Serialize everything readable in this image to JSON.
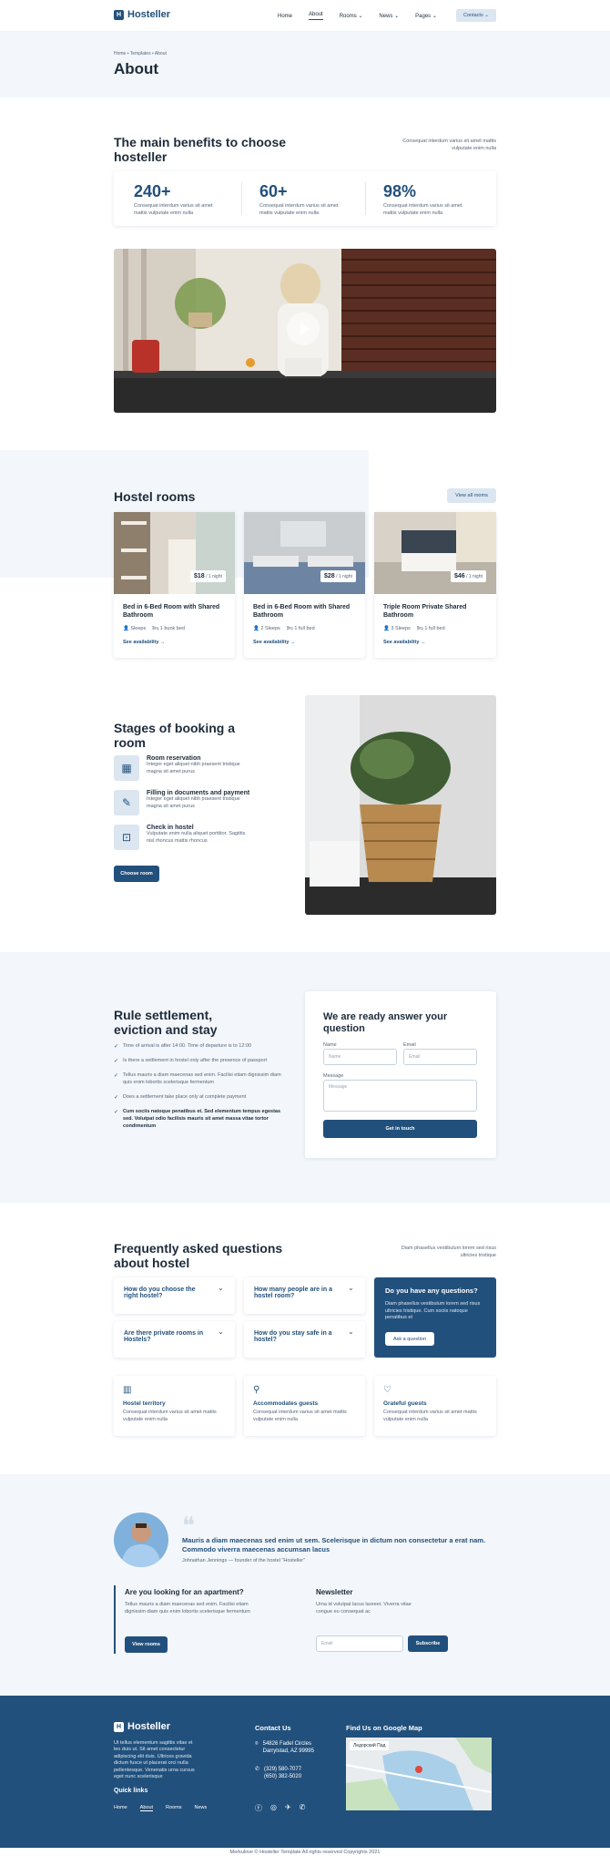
{
  "header": {
    "logo": "Hosteller",
    "nav": [
      "Home",
      "About",
      "Rooms",
      "News",
      "Pages"
    ],
    "contacts": "Contacts"
  },
  "hero": {
    "breadcrumb": "Home • Templates • About",
    "title": "About"
  },
  "benefits": {
    "title": "The main benefits to choose hosteller",
    "side": "Consequat interdum varius sit amet mattis vulputate enim nulla",
    "stats": [
      {
        "value": "240+",
        "text": "Consequat interdum varius sit amet mattis vulputate enim nulla"
      },
      {
        "value": "60+",
        "text": "Consequat interdum varius sit amet mattis vulputate enim nulla"
      },
      {
        "value": "98%",
        "text": "Consequat interdum varius sit amet mattis vulputate enim nulla"
      }
    ]
  },
  "rooms": {
    "title": "Hostel rooms",
    "view_all": "View all rooms",
    "per": "/ 1 night",
    "link": "See availability →",
    "items": [
      {
        "price": "$18",
        "name": "Bed in 6-Bed Room with Shared Bathroom",
        "sleeps": "Sleeps",
        "bed": "1 bunk bed"
      },
      {
        "price": "$28",
        "name": "Bed in 6-Bed Room with Shared Bathroom",
        "sleeps": "2 Sleeps",
        "bed": "1 full bed"
      },
      {
        "price": "$46",
        "name": "Triple Room Private Shared Bathroom",
        "sleeps": "3 Sleeps",
        "bed": "1 full bed"
      }
    ]
  },
  "stages": {
    "title": "Stages of booking a room",
    "button": "Choose room",
    "items": [
      {
        "title": "Room reservation",
        "text": "Integer eget aliquet nibh praesent tristique magna sit amet purus"
      },
      {
        "title": "Filling in documents and payment",
        "text": "Integer eget aliquet nibh praesent tristique magna sit amet purus"
      },
      {
        "title": "Check in hostel",
        "text": "Vulputate enim nulla aliquet porttitor. Sagittis nisl rhoncus mattis rhoncus"
      }
    ]
  },
  "rules": {
    "title": "Rule settlement, eviction and stay",
    "items": [
      "Time of arrival is after 14:00. Time of departure is to 12:00",
      "Is there a settlement in hostel only after the presence of passport",
      "Tellus mauris a diam maecenas sed enim. Facilisi etiam dignissim diam quis enim lobortis scelerisque fermentum",
      "Does a settlement take place only at complete payment",
      "Cum sociis natoque penatibus et. Sed elementum tempus egestas sed. Volutpat odio facilisis mauris sit amet massa vitae tortor condimentum"
    ]
  },
  "form": {
    "title": "We are ready answer your question",
    "name_label": "Name",
    "name_ph": "Name",
    "email_label": "Email",
    "email_ph": "Email",
    "msg_label": "Message",
    "msg_ph": "Message",
    "button": "Get in touch"
  },
  "faq": {
    "title": "Frequently asked questions about hostel",
    "side": "Diam phasellus vestibulum lorem sed risus ultricies tristique",
    "q": [
      "How do you choose the right hostel?",
      "How many people are in a hostel room?",
      "Are there private rooms in Hostels?",
      "How do you stay safe in a hostel?"
    ],
    "box_title": "Do you have any questions?",
    "box_text": "Diam phasellus vestibulum lorem sed risus ultricies tristique. Cum sociis natoque penatibus et",
    "box_button": "Ask a question",
    "features": [
      {
        "title": "Hostel territory",
        "text": "Consequat interdum varius sit amet mattis vulputate enim nulla"
      },
      {
        "title": "Accommodates guests",
        "text": "Consequat interdum varius sit amet mattis vulputate enim nulla"
      },
      {
        "title": "Grateful guests",
        "text": "Consequat interdum varius sit amet mattis vulputate enim nulla"
      }
    ]
  },
  "quote": {
    "text": "Mauris a diam maecenas sed enim ut sem. Scelerisque in dictum non consectetur a erat nam. Commodo viverra maecenas accumsan lacus",
    "author": "Johnathan Jennings — founder of the hostel \"Hosteller\""
  },
  "apartment": {
    "title": "Are you looking for an apartment?",
    "text": "Tellus mauris a diam maecenas sed enim. Facilisi etiam dignissim diam quis enim lobortis scelerisque fermentum",
    "button": "View rooms"
  },
  "newsletter": {
    "title": "Newsletter",
    "text": "Urna id volutpat lacus laoreet. Viverra vitae congue eu consequat ac",
    "placeholder": "Email",
    "button": "Subscribe"
  },
  "footer": {
    "logo": "Hosteller",
    "text": "Ut tellus elementum sagittis vitae et leo duis ut. Sit amet consectetur adipiscing elit duis. Ultrices gravida dictum fusce ut placerat orci nulla pellentesque. Venenatis urna cursus eget nunc scelerisque",
    "quick": "Quick links",
    "links": [
      "Home",
      "About",
      "Rooms",
      "News"
    ],
    "contact_title": "Contact Us",
    "address1": "54826 Fadel Circles",
    "address2": "Darrylstad, AZ 99995",
    "phone1": "(329) 580-7077",
    "phone2": "(650) 382-5020",
    "map_title": "Find Us on Google Map",
    "map_place": "Ледорский Пад",
    "copyright": "Merkulove © Hosteller Template All rights reserved Copyrights 2021"
  },
  "colors": {
    "primary": "#22507c",
    "light": "#f3f7fb"
  }
}
